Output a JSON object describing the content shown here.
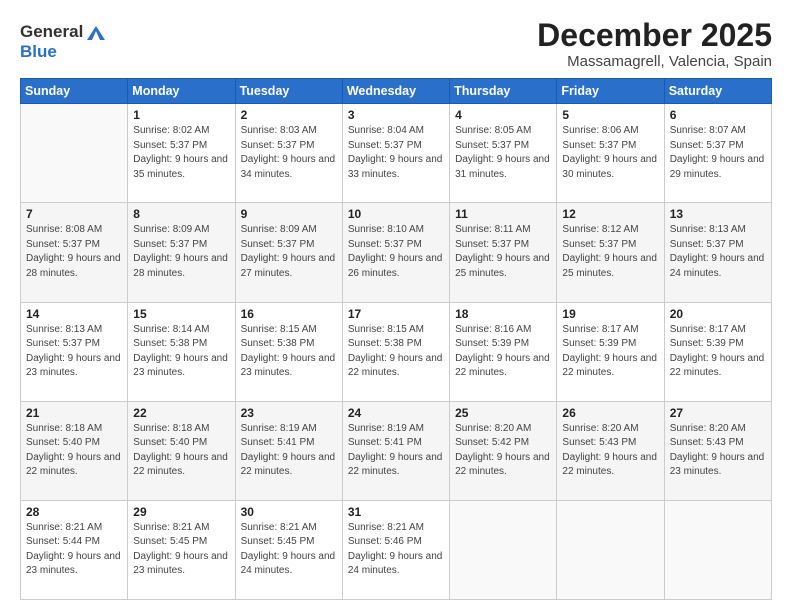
{
  "logo": {
    "general": "General",
    "blue": "Blue"
  },
  "title": "December 2025",
  "subtitle": "Massamagrell, Valencia, Spain",
  "days_header": [
    "Sunday",
    "Monday",
    "Tuesday",
    "Wednesday",
    "Thursday",
    "Friday",
    "Saturday"
  ],
  "weeks": [
    [
      {
        "num": "",
        "empty": true
      },
      {
        "num": "1",
        "rise": "8:02 AM",
        "set": "5:37 PM",
        "daylight": "9 hours and 35 minutes."
      },
      {
        "num": "2",
        "rise": "8:03 AM",
        "set": "5:37 PM",
        "daylight": "9 hours and 34 minutes."
      },
      {
        "num": "3",
        "rise": "8:04 AM",
        "set": "5:37 PM",
        "daylight": "9 hours and 33 minutes."
      },
      {
        "num": "4",
        "rise": "8:05 AM",
        "set": "5:37 PM",
        "daylight": "9 hours and 31 minutes."
      },
      {
        "num": "5",
        "rise": "8:06 AM",
        "set": "5:37 PM",
        "daylight": "9 hours and 30 minutes."
      },
      {
        "num": "6",
        "rise": "8:07 AM",
        "set": "5:37 PM",
        "daylight": "9 hours and 29 minutes."
      }
    ],
    [
      {
        "num": "7",
        "rise": "8:08 AM",
        "set": "5:37 PM",
        "daylight": "9 hours and 28 minutes."
      },
      {
        "num": "8",
        "rise": "8:09 AM",
        "set": "5:37 PM",
        "daylight": "9 hours and 28 minutes."
      },
      {
        "num": "9",
        "rise": "8:09 AM",
        "set": "5:37 PM",
        "daylight": "9 hours and 27 minutes."
      },
      {
        "num": "10",
        "rise": "8:10 AM",
        "set": "5:37 PM",
        "daylight": "9 hours and 26 minutes."
      },
      {
        "num": "11",
        "rise": "8:11 AM",
        "set": "5:37 PM",
        "daylight": "9 hours and 25 minutes."
      },
      {
        "num": "12",
        "rise": "8:12 AM",
        "set": "5:37 PM",
        "daylight": "9 hours and 25 minutes."
      },
      {
        "num": "13",
        "rise": "8:13 AM",
        "set": "5:37 PM",
        "daylight": "9 hours and 24 minutes."
      }
    ],
    [
      {
        "num": "14",
        "rise": "8:13 AM",
        "set": "5:37 PM",
        "daylight": "9 hours and 23 minutes."
      },
      {
        "num": "15",
        "rise": "8:14 AM",
        "set": "5:38 PM",
        "daylight": "9 hours and 23 minutes."
      },
      {
        "num": "16",
        "rise": "8:15 AM",
        "set": "5:38 PM",
        "daylight": "9 hours and 23 minutes."
      },
      {
        "num": "17",
        "rise": "8:15 AM",
        "set": "5:38 PM",
        "daylight": "9 hours and 22 minutes."
      },
      {
        "num": "18",
        "rise": "8:16 AM",
        "set": "5:39 PM",
        "daylight": "9 hours and 22 minutes."
      },
      {
        "num": "19",
        "rise": "8:17 AM",
        "set": "5:39 PM",
        "daylight": "9 hours and 22 minutes."
      },
      {
        "num": "20",
        "rise": "8:17 AM",
        "set": "5:39 PM",
        "daylight": "9 hours and 22 minutes."
      }
    ],
    [
      {
        "num": "21",
        "rise": "8:18 AM",
        "set": "5:40 PM",
        "daylight": "9 hours and 22 minutes."
      },
      {
        "num": "22",
        "rise": "8:18 AM",
        "set": "5:40 PM",
        "daylight": "9 hours and 22 minutes."
      },
      {
        "num": "23",
        "rise": "8:19 AM",
        "set": "5:41 PM",
        "daylight": "9 hours and 22 minutes."
      },
      {
        "num": "24",
        "rise": "8:19 AM",
        "set": "5:41 PM",
        "daylight": "9 hours and 22 minutes."
      },
      {
        "num": "25",
        "rise": "8:20 AM",
        "set": "5:42 PM",
        "daylight": "9 hours and 22 minutes."
      },
      {
        "num": "26",
        "rise": "8:20 AM",
        "set": "5:43 PM",
        "daylight": "9 hours and 22 minutes."
      },
      {
        "num": "27",
        "rise": "8:20 AM",
        "set": "5:43 PM",
        "daylight": "9 hours and 23 minutes."
      }
    ],
    [
      {
        "num": "28",
        "rise": "8:21 AM",
        "set": "5:44 PM",
        "daylight": "9 hours and 23 minutes."
      },
      {
        "num": "29",
        "rise": "8:21 AM",
        "set": "5:45 PM",
        "daylight": "9 hours and 23 minutes."
      },
      {
        "num": "30",
        "rise": "8:21 AM",
        "set": "5:45 PM",
        "daylight": "9 hours and 24 minutes."
      },
      {
        "num": "31",
        "rise": "8:21 AM",
        "set": "5:46 PM",
        "daylight": "9 hours and 24 minutes."
      },
      {
        "num": "",
        "empty": true
      },
      {
        "num": "",
        "empty": true
      },
      {
        "num": "",
        "empty": true
      }
    ]
  ]
}
